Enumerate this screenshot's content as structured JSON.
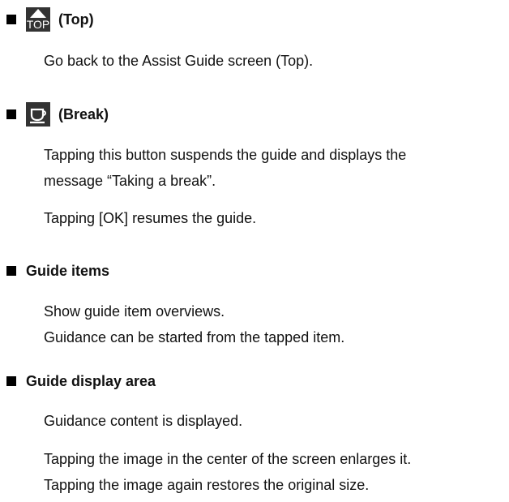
{
  "sections": [
    {
      "heading": "(Top)",
      "icon": "top-icon",
      "icon_text": "TOP",
      "paragraphs": [
        [
          "Go back to the Assist Guide screen (Top)."
        ]
      ]
    },
    {
      "heading": "(Break)",
      "icon": "coffee-cup-icon",
      "paragraphs": [
        [
          "Tapping this button suspends the guide and displays the",
          "message “Taking a break”."
        ],
        [
          "Tapping [OK] resumes the guide."
        ]
      ]
    },
    {
      "heading": "Guide items",
      "paragraphs": [
        [
          "Show guide item overviews.",
          "Guidance can be started from the tapped item."
        ]
      ]
    },
    {
      "heading": "Guide display area",
      "paragraphs": [
        [
          "Guidance content is displayed."
        ],
        [
          "Tapping the image in the center of the screen enlarges it.",
          "Tapping the image again restores the original size."
        ]
      ]
    }
  ]
}
